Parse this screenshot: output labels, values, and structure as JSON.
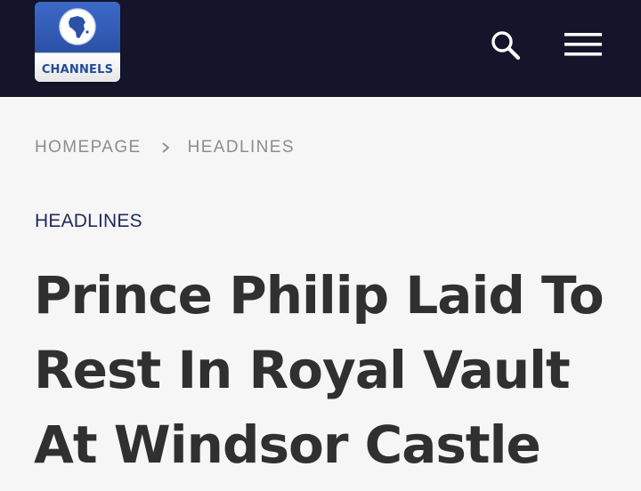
{
  "header": {
    "logo_text": "CHANNELS",
    "search_icon": "search-icon",
    "menu_icon": "hamburger-menu-icon",
    "background": "#14152a"
  },
  "breadcrumb": {
    "items": [
      "HOMEPAGE",
      "HEADLINES"
    ],
    "separator_icon": "chevron-right-icon"
  },
  "article": {
    "category": "HEADLINES",
    "title_lines": [
      "Prince Philip Laid To",
      "Rest In Royal Vault",
      "At Windsor Castle"
    ]
  },
  "colors": {
    "category": "#1e2a59",
    "headline": "#303030",
    "breadcrumb": "#8d8d8d",
    "logo_blue": "#2c52a8"
  }
}
